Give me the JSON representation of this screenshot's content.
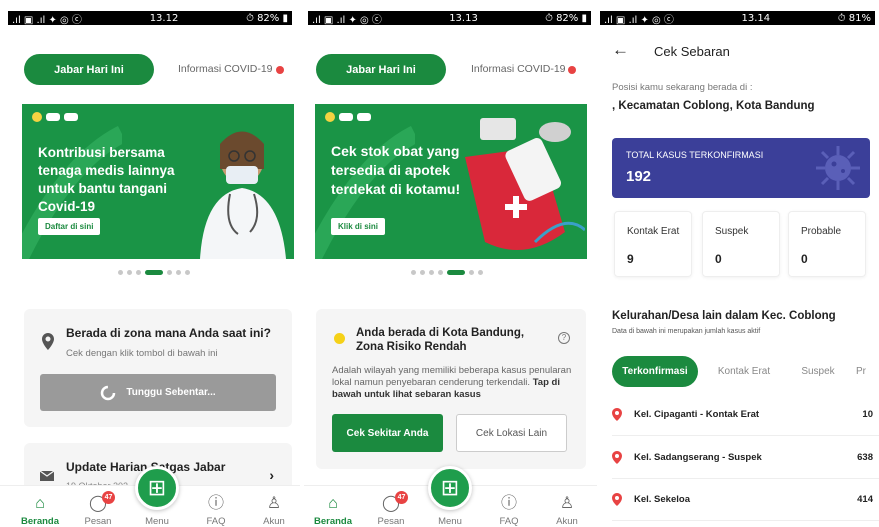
{
  "panel1": {
    "status": {
      "left": ".ıl ▣ .ıl ✦ ◎ ⓒ",
      "time": "13.12",
      "right": "⏱ 82% ▮"
    },
    "top_button": "Jabar Hari Ini",
    "info_link": "Informasi COVID-19",
    "banner": {
      "title": "Kontribusi bersama tenaga medis lainnya untuk bantu tangani Covid-19",
      "button": "Daftar di sini"
    },
    "zone_card": {
      "title": "Berada di zona mana Anda saat ini?",
      "subtitle": "Cek dengan klik tombol di bawah ini",
      "loading_button": "Tunggu Sebentar..."
    },
    "update_card": {
      "title": "Update Harian Satgas Jabar",
      "date": "19 Oktober 202..."
    }
  },
  "panel2": {
    "status": {
      "left": ".ıl ▣ .ıl ✦ ◎ ⓒ",
      "time": "13.13",
      "right": "⏱ 82% ▮"
    },
    "top_button": "Jabar Hari Ini",
    "info_link": "Informasi COVID-19",
    "banner": {
      "title": "Cek stok obat yang tersedia di apotek terdekat di kotamu!",
      "button": "Klik di sini"
    },
    "zone_card": {
      "title": "Anda berada di Kota Bandung, Zona Risiko Rendah",
      "desc": "Adalah wilayah yang memiliki beberapa kasus penularan lokal namun penyebaran cenderung terkendali.",
      "desc_bold": "Tap di bawah untuk lihat sebaran kasus",
      "btn_primary": "Cek Sekitar Anda",
      "btn_secondary": "Cek Lokasi Lain"
    }
  },
  "panel3": {
    "status": {
      "left": ".ıl ▣ .ıl ✦ ◎ ⓒ",
      "time": "13.14",
      "right": "⏱ 81%"
    },
    "header_title": "Cek Sebaran",
    "position_label": "Posisi kamu sekarang berada di :",
    "position_value": ", Kecamatan Coblong, Kota Bandung",
    "total_label": "TOTAL KASUS TERKONFIRMASI",
    "total_value": "192",
    "stats": [
      {
        "label": "Kontak Erat",
        "value": "9"
      },
      {
        "label": "Suspek",
        "value": "0"
      },
      {
        "label": "Probable",
        "value": "0"
      }
    ],
    "section_title": "Kelurahan/Desa lain dalam Kec. Coblong",
    "section_note": "Data di bawah ini merupakan jumlah kasus aktif",
    "tabs": [
      "Terkonfirmasi",
      "Kontak Erat",
      "Suspek",
      "Pr"
    ],
    "rows": [
      {
        "name": "Kel. Cipaganti - Kontak Erat",
        "value": "10"
      },
      {
        "name": "Kel. Sadangserang - Suspek",
        "value": "638"
      },
      {
        "name": "Kel. Sekeloa",
        "value": "414"
      }
    ]
  },
  "nav": {
    "home": "Beranda",
    "inbox": "Pesan",
    "inbox_badge": "47",
    "menu": "Menu",
    "faq": "FAQ",
    "account": "Akun"
  },
  "colors": {
    "primary": "#1b8a3f",
    "total_card": "#3b3f99",
    "alert": "#e84343"
  }
}
